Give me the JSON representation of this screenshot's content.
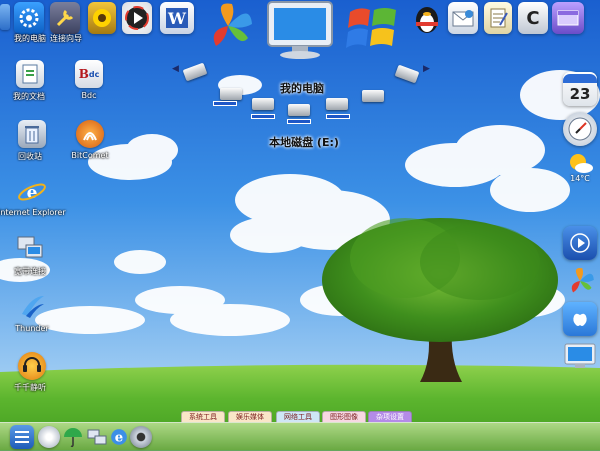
{
  "desktop_icons": [
    {
      "label": "我的电脑",
      "icon": "computer-icon"
    },
    {
      "label": "我的文档",
      "icon": "documents-icon"
    },
    {
      "label": "回收站",
      "icon": "recycle-bin-icon"
    },
    {
      "label": "Internet Explorer",
      "icon": "ie-icon"
    },
    {
      "label": "宽带连接",
      "icon": "network-icon"
    },
    {
      "label": "Thunder",
      "icon": "thunder-icon"
    },
    {
      "label": "千千静听",
      "icon": "music-player-icon"
    },
    {
      "label": "Bdc",
      "icon": "bdc-icon"
    },
    {
      "label": "BitComet",
      "icon": "bitcomet-icon"
    }
  ],
  "top_icons": [
    {
      "label": "我的电脑",
      "icon": "gear-computer-icon"
    },
    {
      "label": "连接向导",
      "icon": "wrench-icon"
    }
  ],
  "carousel": {
    "title": "我的电脑",
    "subtitle": "本地磁盘 (E:)",
    "left_arrow": "◀",
    "right_arrow": "▶"
  },
  "calendar": {
    "day": "23"
  },
  "weather": {
    "temp": "14°C"
  },
  "taskbar_tabs": [
    "系统工具",
    "娱乐媒体",
    "网络工具",
    "图形图像",
    "杂项设置"
  ],
  "colors": {
    "sky_top": "#1a64d4",
    "sky_bottom": "#bfe0f7",
    "grass": "#5ab42a",
    "tab_active": "#b48be8"
  }
}
